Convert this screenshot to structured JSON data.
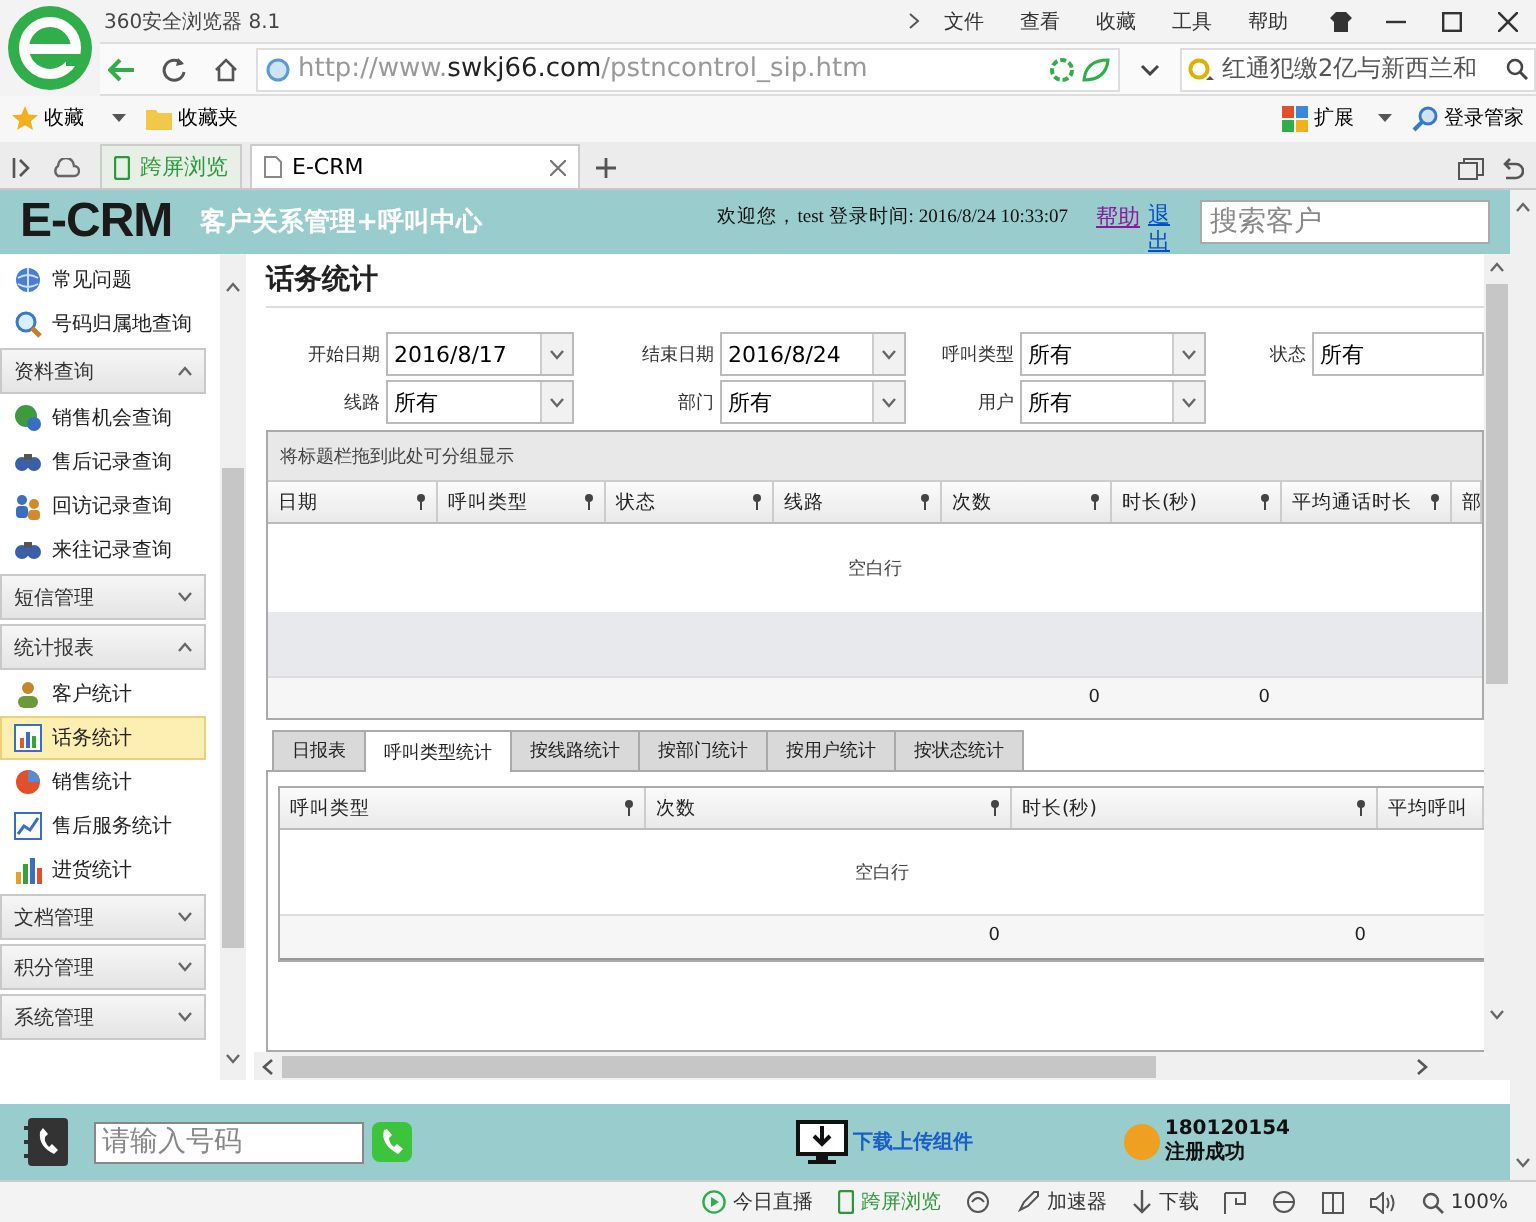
{
  "browser": {
    "title": "360安全浏览器 8.1",
    "menu": [
      "文件",
      "查看",
      "收藏",
      "工具",
      "帮助"
    ],
    "url": {
      "prefix": "http://www.",
      "domain": "swkj66.com",
      "path": "/pstncontrol_sip.htm"
    },
    "search_text": "红通犯缴2亿与新西兰和",
    "bookmarks": [
      {
        "kind": "favorites",
        "label": "收藏"
      },
      {
        "kind": "folder",
        "label": "收藏夹"
      }
    ],
    "extensions": "扩展",
    "login_manager": "登录管家",
    "tabs": [
      {
        "kind": "cross-screen",
        "label": "跨屏浏览",
        "selected": false
      },
      {
        "kind": "page",
        "label": "E-CRM",
        "selected": true
      }
    ]
  },
  "header": {
    "logo": "E-CRM",
    "subtitle": "客户关系管理+呼叫中心",
    "welcome": "欢迎您，test 登录时间: 2016/8/24 10:33:07",
    "links": [
      "帮助",
      "退出"
    ],
    "search": {
      "placeholder": "搜索客户"
    }
  },
  "sidebar": {
    "items": [
      {
        "kind": "item",
        "label": "常见问题",
        "selected": false
      },
      {
        "kind": "item",
        "label": "号码归属地查询",
        "selected": false
      },
      {
        "kind": "group",
        "label": "资料查询",
        "expanded": true
      },
      {
        "kind": "item",
        "label": "销售机会查询",
        "selected": false
      },
      {
        "kind": "item",
        "label": "售后记录查询",
        "selected": false
      },
      {
        "kind": "item",
        "label": "回访记录查询",
        "selected": false
      },
      {
        "kind": "item",
        "label": "来往记录查询",
        "selected": false
      },
      {
        "kind": "group",
        "label": "短信管理",
        "expanded": false
      },
      {
        "kind": "group",
        "label": "统计报表",
        "expanded": true
      },
      {
        "kind": "item",
        "label": "客户统计",
        "selected": false
      },
      {
        "kind": "item",
        "label": "话务统计",
        "selected": true
      },
      {
        "kind": "item",
        "label": "销售统计",
        "selected": false
      },
      {
        "kind": "item",
        "label": "售后服务统计",
        "selected": false
      },
      {
        "kind": "item",
        "label": "进货统计",
        "selected": false
      },
      {
        "kind": "group",
        "label": "文档管理",
        "expanded": false
      },
      {
        "kind": "group",
        "label": "积分管理",
        "expanded": false
      },
      {
        "kind": "group",
        "label": "系统管理",
        "expanded": false
      }
    ]
  },
  "main": {
    "title": "话务统计",
    "filters": [
      {
        "label": "开始日期",
        "value": "2016/8/17"
      },
      {
        "label": "结束日期",
        "value": "2016/8/24"
      },
      {
        "label": "呼叫类型",
        "value": "所有"
      },
      {
        "label": "状态",
        "value": "所有"
      },
      {
        "label": "线路",
        "value": "所有"
      },
      {
        "label": "部门",
        "value": "所有"
      },
      {
        "label": "用户",
        "value": "所有"
      }
    ],
    "grid": {
      "group_hint": "将标题栏拖到此处可分组显示",
      "columns": [
        {
          "label": "日期"
        },
        {
          "label": "呼叫类型"
        },
        {
          "label": "状态"
        },
        {
          "label": "线路"
        },
        {
          "label": "次数",
          "total": "0"
        },
        {
          "label": "时长(秒)",
          "total": "0"
        },
        {
          "label": "平均通话时长"
        },
        {
          "label": "部"
        }
      ],
      "empty_text": "空白行"
    },
    "tabs": [
      {
        "label": "日报表",
        "selected": false
      },
      {
        "label": "呼叫类型统计",
        "selected": true
      },
      {
        "label": "按线路统计",
        "selected": false
      },
      {
        "label": "按部门统计",
        "selected": false
      },
      {
        "label": "按用户统计",
        "selected": false
      },
      {
        "label": "按状态统计",
        "selected": false
      }
    ],
    "tab_grid": {
      "columns": [
        {
          "label": "呼叫类型"
        },
        {
          "label": "次数",
          "total": "0"
        },
        {
          "label": "时长(秒)",
          "total": "0"
        },
        {
          "label": "平均呼叫"
        }
      ],
      "empty_text": "空白行"
    }
  },
  "call_bar": {
    "placeholder": "请输入号码",
    "download": "下载上传组件",
    "account": "180120154",
    "register_status": "注册成功"
  },
  "status_bar": {
    "live": "今日直播",
    "cross_screen": "跨屏浏览",
    "accelerator": "加速器",
    "download": "下载",
    "zoom": "100%"
  }
}
